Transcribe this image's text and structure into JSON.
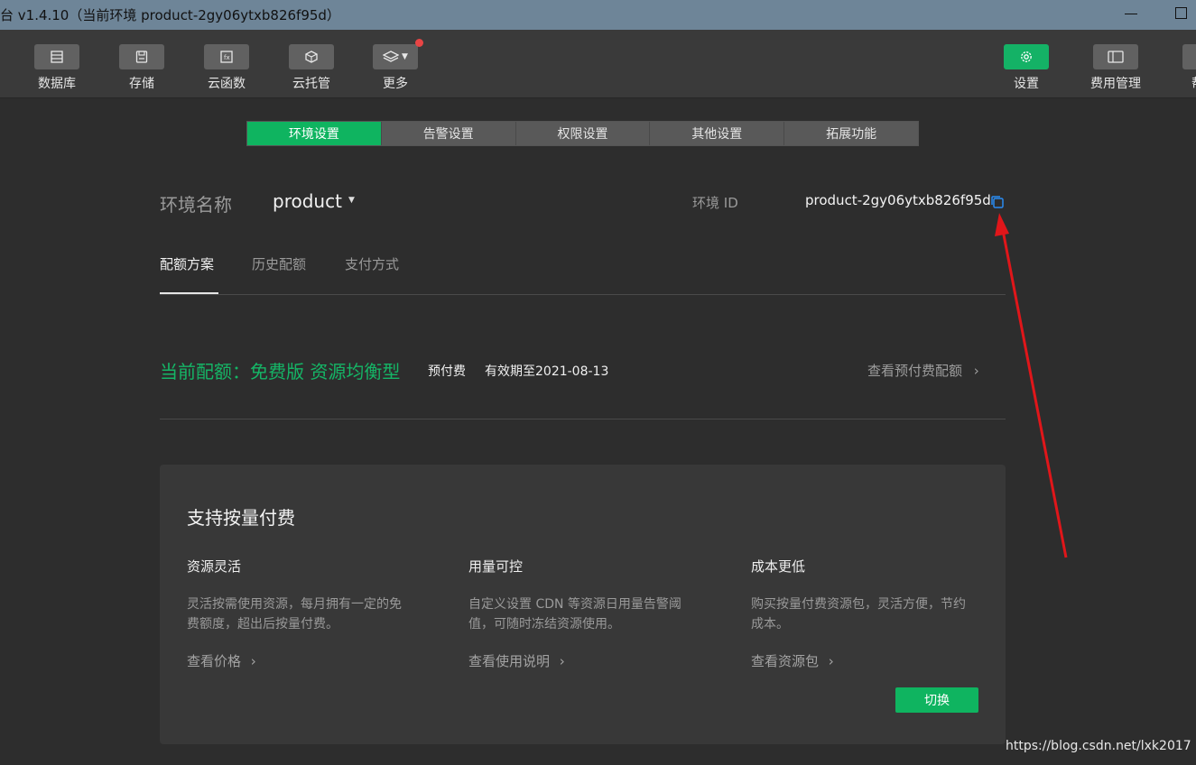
{
  "window": {
    "title": "台 v1.4.10（当前环境 product-2gy06ytxb826f95d）"
  },
  "toolbar": {
    "left_items": [
      {
        "label": "数据库",
        "icon": "database-icon"
      },
      {
        "label": "存储",
        "icon": "storage-icon"
      },
      {
        "label": "云函数",
        "icon": "function-icon"
      },
      {
        "label": "云托管",
        "icon": "cloud-hosting-icon"
      },
      {
        "label": "更多",
        "icon": "layers-icon"
      }
    ],
    "right_items": [
      {
        "label": "设置",
        "icon": "gear-icon"
      },
      {
        "label": "费用管理",
        "icon": "billing-icon"
      },
      {
        "label": "帮",
        "icon": "help-icon"
      }
    ]
  },
  "tabs": [
    "环境设置",
    "告警设置",
    "权限设置",
    "其他设置",
    "拓展功能"
  ],
  "env": {
    "name_label": "环境名称",
    "name_value": "product",
    "id_label": "环境 ID",
    "id_value": "product-2gy06ytxb826f95d"
  },
  "subtabs": [
    "配额方案",
    "历史配额",
    "支付方式"
  ],
  "quota": {
    "current": "当前配额：免费版 资源均衡型",
    "pay_type": "预付费",
    "valid_until": "有效期至2021-08-13",
    "view_link": "查看预付费配额"
  },
  "card": {
    "title": "支持按量付费",
    "columns": [
      {
        "title": "资源灵活",
        "desc": "灵活按需使用资源，每月拥有一定的免费额度，超出后按量付费。",
        "link": "查看价格"
      },
      {
        "title": "用量可控",
        "desc": "自定义设置 CDN 等资源日用量告警阈值，可随时冻结资源使用。",
        "link": "查看使用说明"
      },
      {
        "title": "成本更低",
        "desc": "购买按量付费资源包，灵活方便，节约成本。",
        "link": "查看资源包"
      }
    ],
    "switch_label": "切换"
  },
  "watermark": "https://blog.csdn.net/lxk2017",
  "colors": {
    "accent": "#0fb460",
    "arrow": "#e0161a",
    "copy_icon": "#2a8bf2",
    "notification_dot": "#e84545"
  }
}
